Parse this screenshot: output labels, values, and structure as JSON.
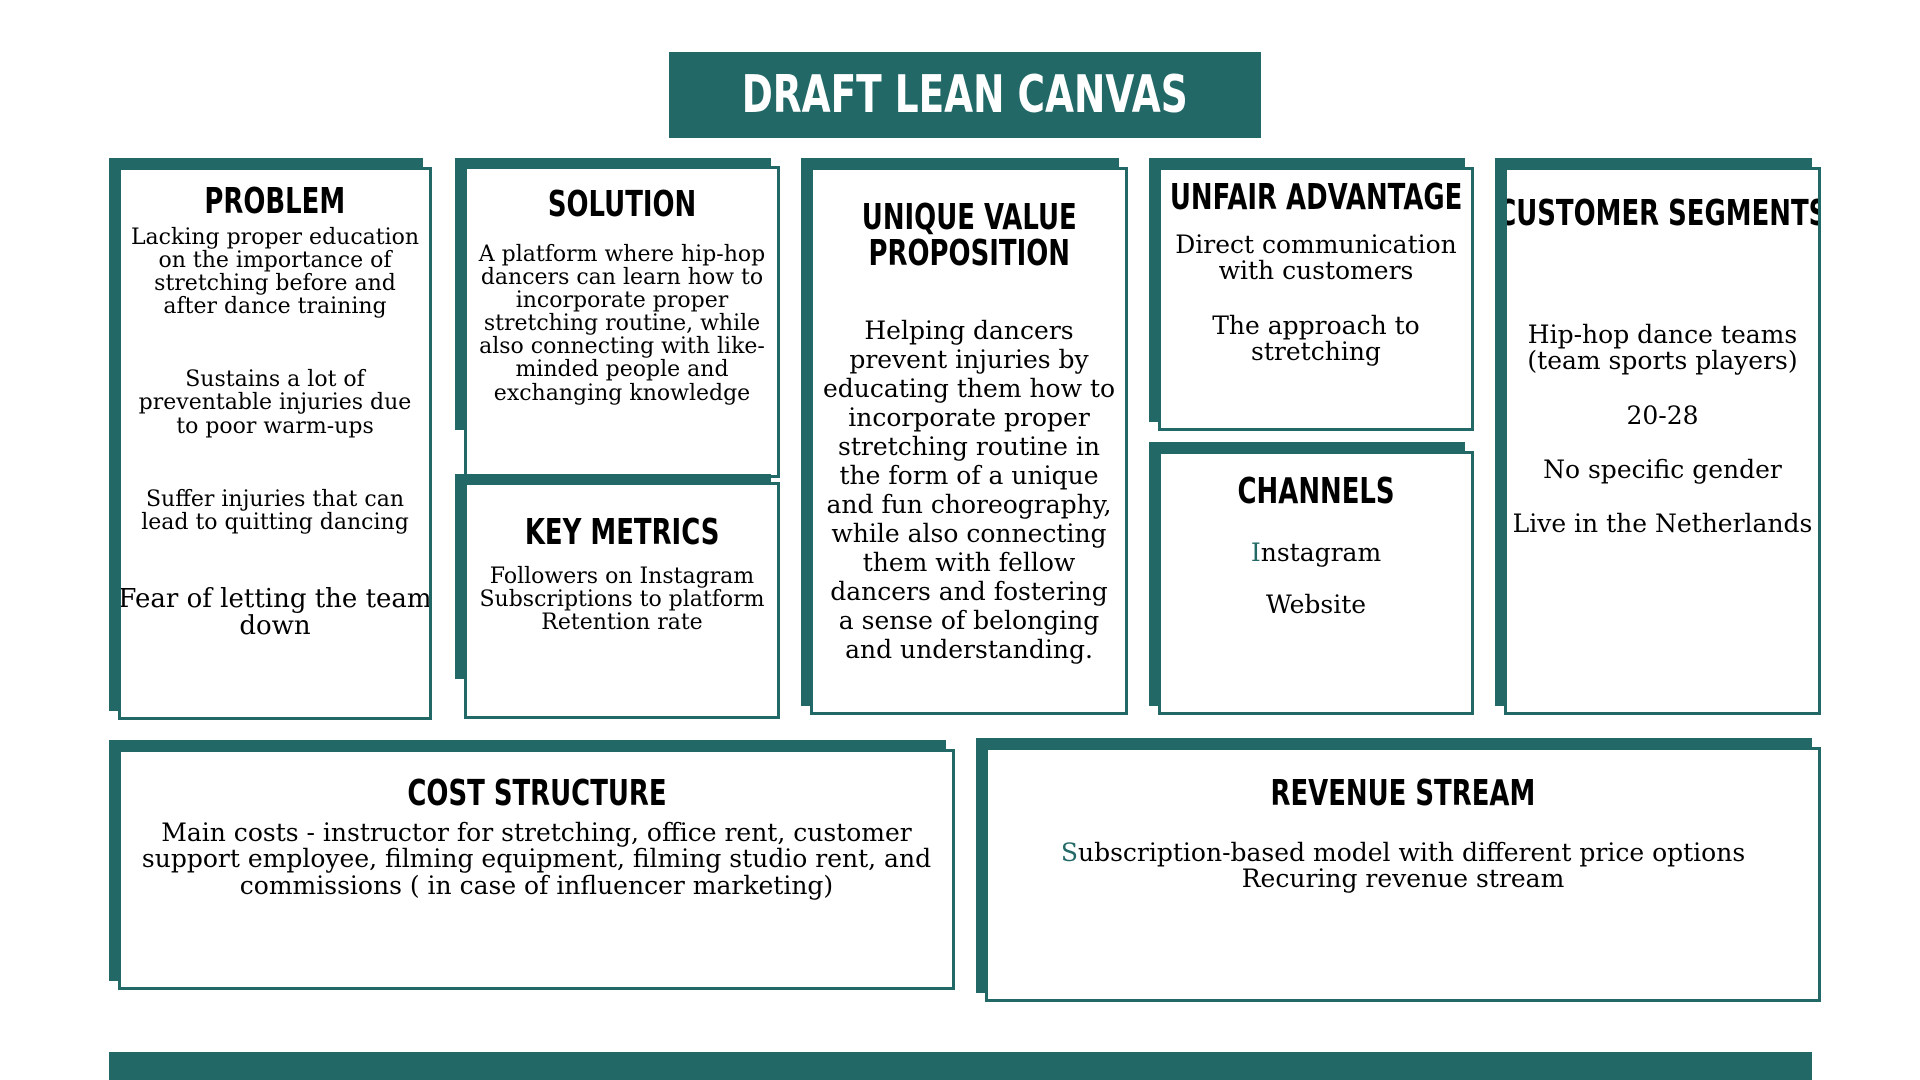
{
  "title": "DRAFT LEAN CANVAS",
  "problem": {
    "heading": "PROBLEM",
    "item1": [
      "Lacking proper education",
      "on the importance of",
      "stretching before and",
      "after dance training"
    ],
    "item2": [
      "Sustains a lot of",
      "preventable injuries due",
      "to poor warm-ups"
    ],
    "item3": [
      "Suffer injuries that can",
      "lead to quitting dancing"
    ],
    "item4": [
      "Fear of letting the team",
      "down"
    ]
  },
  "solution": {
    "heading": "SOLUTION",
    "text": [
      "A platform where hip-hop",
      "dancers can learn how to",
      "incorporate proper",
      "stretching routine, while",
      "also connecting with like-",
      "minded people and",
      "exchanging knowledge"
    ]
  },
  "key_metrics": {
    "heading": "KEY METRICS",
    "text": [
      "Followers on Instagram",
      "Subscriptions to platform",
      "Retention rate"
    ]
  },
  "uvp": {
    "heading": [
      "UNIQUE VALUE",
      "PROPOSITION"
    ],
    "text": [
      "Helping dancers",
      "prevent injuries by",
      "educating them how to",
      "incorporate proper",
      "stretching routine in",
      "the form of a unique",
      "and fun choreography,",
      "while also connecting",
      "them with fellow",
      "dancers and fostering",
      "a sense of belonging",
      "and understanding."
    ]
  },
  "unfair_advantage": {
    "heading": "UNFAIR ADVANTAGE",
    "item1": [
      "Direct communication",
      "with customers"
    ],
    "item2": [
      "The approach to",
      "stretching"
    ]
  },
  "channels": {
    "heading": "CHANNELS",
    "item1": "Instagram",
    "item2": "Website"
  },
  "customer_segments": {
    "heading": "CUSTOMER SEGMENTS",
    "item1": [
      "Hip-hop dance teams",
      "(team sports players)"
    ],
    "item2": "20-28",
    "item3": "No specific gender",
    "item4": "Live in the Netherlands"
  },
  "cost_structure": {
    "heading": "COST STRUCTURE",
    "text": [
      "Main costs - instructor for stretching, office rent, customer",
      "support employee, filming equipment, filming studio rent, and",
      "commissions ( in case of influencer marketing)"
    ]
  },
  "revenue_stream": {
    "heading": "REVENUE STREAM",
    "text": [
      "Subscription-based model with different price options",
      "Recuring revenue stream"
    ]
  },
  "colors": {
    "accent": "#216866",
    "background": "#ffffff",
    "text": "#000000"
  }
}
